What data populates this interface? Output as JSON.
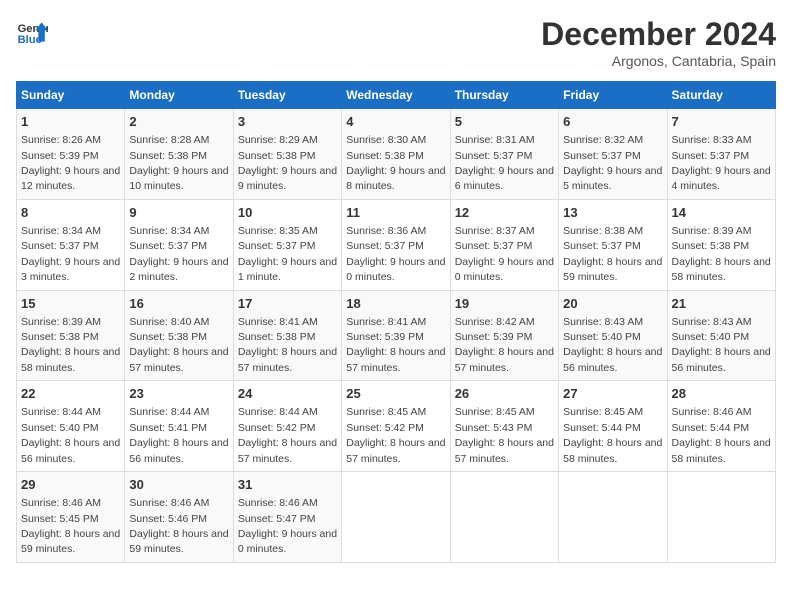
{
  "header": {
    "logo_line1": "General",
    "logo_line2": "Blue",
    "month": "December 2024",
    "location": "Argonos, Cantabria, Spain"
  },
  "weekdays": [
    "Sunday",
    "Monday",
    "Tuesday",
    "Wednesday",
    "Thursday",
    "Friday",
    "Saturday"
  ],
  "weeks": [
    [
      {
        "day": "1",
        "rise": "8:26 AM",
        "set": "5:39 PM",
        "daylight": "9 hours and 12 minutes."
      },
      {
        "day": "2",
        "rise": "8:28 AM",
        "set": "5:38 PM",
        "daylight": "9 hours and 10 minutes."
      },
      {
        "day": "3",
        "rise": "8:29 AM",
        "set": "5:38 PM",
        "daylight": "9 hours and 9 minutes."
      },
      {
        "day": "4",
        "rise": "8:30 AM",
        "set": "5:38 PM",
        "daylight": "9 hours and 8 minutes."
      },
      {
        "day": "5",
        "rise": "8:31 AM",
        "set": "5:37 PM",
        "daylight": "9 hours and 6 minutes."
      },
      {
        "day": "6",
        "rise": "8:32 AM",
        "set": "5:37 PM",
        "daylight": "9 hours and 5 minutes."
      },
      {
        "day": "7",
        "rise": "8:33 AM",
        "set": "5:37 PM",
        "daylight": "9 hours and 4 minutes."
      }
    ],
    [
      {
        "day": "8",
        "rise": "8:34 AM",
        "set": "5:37 PM",
        "daylight": "9 hours and 3 minutes."
      },
      {
        "day": "9",
        "rise": "8:34 AM",
        "set": "5:37 PM",
        "daylight": "9 hours and 2 minutes."
      },
      {
        "day": "10",
        "rise": "8:35 AM",
        "set": "5:37 PM",
        "daylight": "9 hours and 1 minute."
      },
      {
        "day": "11",
        "rise": "8:36 AM",
        "set": "5:37 PM",
        "daylight": "9 hours and 0 minutes."
      },
      {
        "day": "12",
        "rise": "8:37 AM",
        "set": "5:37 PM",
        "daylight": "9 hours and 0 minutes."
      },
      {
        "day": "13",
        "rise": "8:38 AM",
        "set": "5:37 PM",
        "daylight": "8 hours and 59 minutes."
      },
      {
        "day": "14",
        "rise": "8:39 AM",
        "set": "5:38 PM",
        "daylight": "8 hours and 58 minutes."
      }
    ],
    [
      {
        "day": "15",
        "rise": "8:39 AM",
        "set": "5:38 PM",
        "daylight": "8 hours and 58 minutes."
      },
      {
        "day": "16",
        "rise": "8:40 AM",
        "set": "5:38 PM",
        "daylight": "8 hours and 57 minutes."
      },
      {
        "day": "17",
        "rise": "8:41 AM",
        "set": "5:38 PM",
        "daylight": "8 hours and 57 minutes."
      },
      {
        "day": "18",
        "rise": "8:41 AM",
        "set": "5:39 PM",
        "daylight": "8 hours and 57 minutes."
      },
      {
        "day": "19",
        "rise": "8:42 AM",
        "set": "5:39 PM",
        "daylight": "8 hours and 57 minutes."
      },
      {
        "day": "20",
        "rise": "8:43 AM",
        "set": "5:40 PM",
        "daylight": "8 hours and 56 minutes."
      },
      {
        "day": "21",
        "rise": "8:43 AM",
        "set": "5:40 PM",
        "daylight": "8 hours and 56 minutes."
      }
    ],
    [
      {
        "day": "22",
        "rise": "8:44 AM",
        "set": "5:40 PM",
        "daylight": "8 hours and 56 minutes."
      },
      {
        "day": "23",
        "rise": "8:44 AM",
        "set": "5:41 PM",
        "daylight": "8 hours and 56 minutes."
      },
      {
        "day": "24",
        "rise": "8:44 AM",
        "set": "5:42 PM",
        "daylight": "8 hours and 57 minutes."
      },
      {
        "day": "25",
        "rise": "8:45 AM",
        "set": "5:42 PM",
        "daylight": "8 hours and 57 minutes."
      },
      {
        "day": "26",
        "rise": "8:45 AM",
        "set": "5:43 PM",
        "daylight": "8 hours and 57 minutes."
      },
      {
        "day": "27",
        "rise": "8:45 AM",
        "set": "5:44 PM",
        "daylight": "8 hours and 58 minutes."
      },
      {
        "day": "28",
        "rise": "8:46 AM",
        "set": "5:44 PM",
        "daylight": "8 hours and 58 minutes."
      }
    ],
    [
      {
        "day": "29",
        "rise": "8:46 AM",
        "set": "5:45 PM",
        "daylight": "8 hours and 59 minutes."
      },
      {
        "day": "30",
        "rise": "8:46 AM",
        "set": "5:46 PM",
        "daylight": "8 hours and 59 minutes."
      },
      {
        "day": "31",
        "rise": "8:46 AM",
        "set": "5:47 PM",
        "daylight": "9 hours and 0 minutes."
      },
      null,
      null,
      null,
      null
    ]
  ]
}
